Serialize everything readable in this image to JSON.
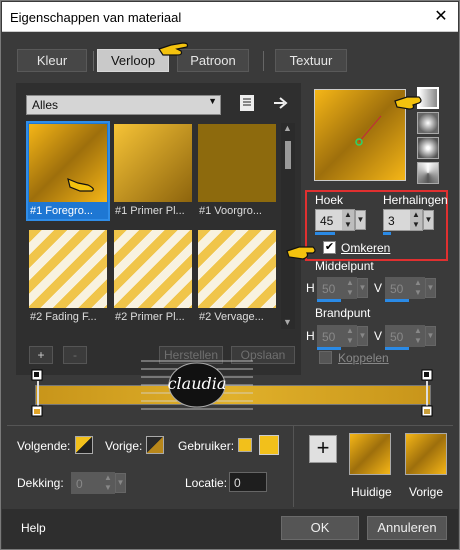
{
  "window": {
    "title": "Eigenschappen van materiaal",
    "close_icon": "close-icon"
  },
  "tabs": [
    {
      "label": "Kleur"
    },
    {
      "label": "Verloop"
    },
    {
      "label": "Patroon"
    },
    {
      "label": "Textuur"
    }
  ],
  "category": {
    "value": "Alles"
  },
  "thumbnails": [
    {
      "label": "#1 Foregro..."
    },
    {
      "label": "#1 Primer Pl..."
    },
    {
      "label": "#1 Voorgro..."
    },
    {
      "label": "#2 Fading F..."
    },
    {
      "label": "#2 Primer Pl..."
    },
    {
      "label": "#2 Vervage..."
    }
  ],
  "controls": {
    "hoek_label": "Hoek",
    "hoek_value": "45",
    "herhalingen_label": "Herhalingen",
    "herhalingen_value": "3",
    "omkeren_label": "Omkeren",
    "middelpunt_label": "Middelpunt",
    "brandpunt_label": "Brandpunt",
    "h_label": "H",
    "v_label": "V",
    "mid_h": "50",
    "mid_v": "50",
    "brand_h": "50",
    "brand_v": "50",
    "koppelen_label": "Koppelen"
  },
  "buttons": {
    "plus": "+",
    "minus": "-",
    "herstellen": "Herstellen",
    "opslaan": "Opslaan",
    "add": "+"
  },
  "watermark": "claudia",
  "bottom": {
    "volgende": "Volgende:",
    "vorige": "Vorige:",
    "gebruiker": "Gebruiker:",
    "dekking": "Dekking:",
    "dekking_value": "0",
    "locatie": "Locatie:",
    "locatie_value": "0",
    "huidige": "Huidige",
    "vorige_swatch": "Vorige"
  },
  "footer": {
    "help": "Help",
    "ok": "OK",
    "cancel": "Annuleren"
  },
  "colors": {
    "gold": "#dca925",
    "highlight": "#e03030",
    "selection": "#1e77d3"
  }
}
